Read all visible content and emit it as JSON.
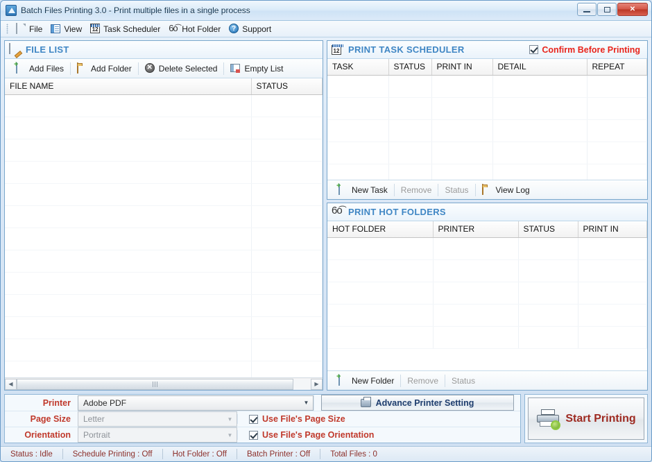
{
  "window": {
    "title": "Batch Files Printing 3.0 - Print multiple files in a single process",
    "app_icon": "app-printer-icon",
    "minimize": "minimize-icon",
    "maximize": "maximize-icon",
    "close": "✕"
  },
  "menubar": {
    "items": [
      {
        "label": "File",
        "icon": "file-page-icon"
      },
      {
        "label": "View",
        "icon": "list-view-icon"
      },
      {
        "label": "Task Scheduler",
        "icon": "calendar-12-icon"
      },
      {
        "label": "Hot Folder",
        "icon": "glasses-icon"
      },
      {
        "label": "Support",
        "icon": "help-circle-icon"
      }
    ]
  },
  "file_list": {
    "title": "FILE LIST",
    "title_icon": "pencil-note-icon",
    "actions": [
      {
        "label": "Add Files",
        "icon": "add-page-icon",
        "enabled": true
      },
      {
        "label": "Add Folder",
        "icon": "folder-icon",
        "enabled": true
      },
      {
        "label": "Delete Selected",
        "icon": "delete-circle-icon",
        "enabled": true
      },
      {
        "label": "Empty List",
        "icon": "empty-list-icon",
        "enabled": true
      }
    ],
    "columns": [
      "FILE NAME",
      "STATUS"
    ],
    "rows": [],
    "scrollbar": {
      "left_arrow": "◀",
      "right_arrow": "▶",
      "grip": "scroll-grip"
    }
  },
  "scheduler": {
    "title": "PRINT TASK SCHEDULER",
    "title_icon": "calendar-12-icon",
    "confirm_checkbox": {
      "label": "Confirm Before Printing",
      "checked": true
    },
    "columns": [
      "TASK",
      "STATUS",
      "PRINT IN",
      "DETAIL",
      "REPEAT"
    ],
    "rows": [],
    "actions": [
      {
        "label": "New Task",
        "icon": "add-page-icon",
        "enabled": true
      },
      {
        "label": "Remove",
        "icon": "",
        "enabled": false
      },
      {
        "label": "Status",
        "icon": "",
        "enabled": false
      },
      {
        "label": "View Log",
        "icon": "folder-icon",
        "enabled": true
      }
    ]
  },
  "hot_folders": {
    "title": "PRINT HOT FOLDERS",
    "title_icon": "glasses-icon",
    "columns": [
      "HOT FOLDER",
      "PRINTER",
      "STATUS",
      "PRINT IN"
    ],
    "rows": [],
    "actions": [
      {
        "label": "New Folder",
        "icon": "add-page-icon",
        "enabled": true
      },
      {
        "label": "Remove",
        "icon": "",
        "enabled": false
      },
      {
        "label": "Status",
        "icon": "",
        "enabled": false
      }
    ]
  },
  "settings": {
    "printer": {
      "label": "Printer",
      "value": "Adobe PDF",
      "enabled": true
    },
    "page_size": {
      "label": "Page Size",
      "value": "Letter",
      "enabled": false
    },
    "orientation": {
      "label": "Orientation",
      "value": "Portrait",
      "enabled": false
    },
    "use_file_page_size": {
      "label": "Use File's Page Size",
      "checked": true
    },
    "use_file_page_orientation": {
      "label": "Use File's Page Orientation",
      "checked": true
    },
    "advance_button": {
      "label": "Advance Printer Setting",
      "icon": "printer-icon"
    },
    "start_button": {
      "label": "Start Printing",
      "icon": "printer-gear-icon"
    }
  },
  "statusbar": {
    "cells": [
      "Status :  Idle",
      "Schedule Printing : Off",
      "Hot Folder : Off",
      "Batch Printer : Off",
      "Total Files :  0"
    ]
  },
  "colors": {
    "panel_title": "#3f86c4",
    "alert_red": "#e8241b",
    "label_red": "#c0392b",
    "status_text": "#8c2f2a",
    "start_label": "#9e2a21",
    "advance_label": "#1f3e6e"
  }
}
